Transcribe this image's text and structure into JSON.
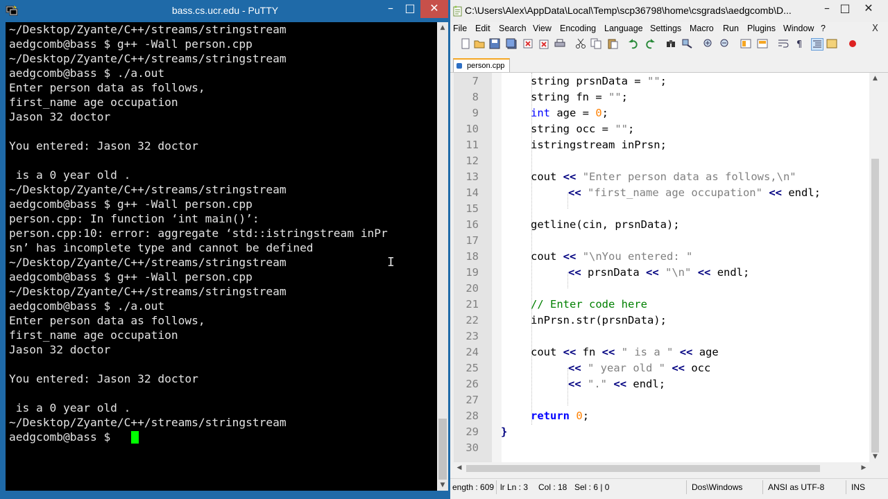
{
  "putty": {
    "title": "bass.cs.ucr.edu - PuTTY",
    "minimize_glyph": "–",
    "maximize_glyph": "□",
    "close_glyph": "✕",
    "terminal_lines": [
      "~/Desktop/Zyante/C++/streams/stringstream",
      "aedgcomb@bass $ g++ -Wall person.cpp",
      "~/Desktop/Zyante/C++/streams/stringstream",
      "aedgcomb@bass $ ./a.out",
      "Enter person data as follows,",
      "first_name age occupation",
      "Jason 32 doctor",
      "",
      "You entered: Jason 32 doctor",
      "",
      " is a 0 year old .",
      "~/Desktop/Zyante/C++/streams/stringstream",
      "aedgcomb@bass $ g++ -Wall person.cpp",
      "person.cpp: In function ‘int main()’:",
      "person.cpp:10: error: aggregate ‘std::istringstream inPr",
      "sn’ has incomplete type and cannot be defined",
      "~/Desktop/Zyante/C++/streams/stringstream",
      "aedgcomb@bass $ g++ -Wall person.cpp",
      "~/Desktop/Zyante/C++/streams/stringstream",
      "aedgcomb@bass $ ./a.out",
      "Enter person data as follows,",
      "first_name age occupation",
      "Jason 32 doctor",
      "",
      "You entered: Jason 32 doctor",
      "",
      " is a 0 year old .",
      "~/Desktop/Zyante/C++/streams/stringstream",
      "aedgcomb@bass $ "
    ],
    "cursor_color": "#00ff00",
    "scroll_up": "▲",
    "scroll_down": "▼"
  },
  "npp": {
    "title": "C:\\Users\\Alex\\AppData\\Local\\Temp\\scp36798\\home\\csgrads\\aedgcomb\\D...",
    "minimize_glyph": "–",
    "maximize_glyph": "□",
    "close_glyph": "✕",
    "menu": [
      "File",
      "Edit",
      "Search",
      "View",
      "Encoding",
      "Language",
      "Settings",
      "Macro",
      "Run",
      "Plugins",
      "Window",
      "?"
    ],
    "menu_close": "X",
    "toolbar_icons": [
      "new-file-icon",
      "open-file-icon",
      "save-icon",
      "save-all-icon",
      "close-icon",
      "close-all-icon",
      "print-icon",
      "cut-icon",
      "copy-icon",
      "paste-icon",
      "undo-icon",
      "redo-icon",
      "find-icon",
      "replace-icon",
      "zoom-in-icon",
      "zoom-out-icon",
      "sync-v-icon",
      "sync-h-icon",
      "word-wrap-icon",
      "show-all-chars-icon",
      "indent-guide-icon",
      "user-lang-icon",
      "record-macro-icon"
    ],
    "tab": "person.cpp",
    "line_numbers": [
      "7",
      "8",
      "9",
      "10",
      "11",
      "12",
      "13",
      "14",
      "15",
      "16",
      "17",
      "18",
      "19",
      "20",
      "21",
      "22",
      "23",
      "24",
      "25",
      "26",
      "27",
      "28",
      "29",
      "30"
    ],
    "code": {
      "l7": {
        "t1": "string prsnData = ",
        "s": "\"\"",
        "t2": ";"
      },
      "l8": {
        "t1": "string fn = ",
        "s": "\"\"",
        "t2": ";"
      },
      "l9": {
        "kw": "int",
        "t1": " age = ",
        "num": "0",
        "t2": ";"
      },
      "l10": {
        "t1": "string occ = ",
        "s": "\"\"",
        "t2": ";"
      },
      "l11": {
        "t1": "istringstream inPrsn;"
      },
      "l13": {
        "t1": "cout ",
        "op": "<<",
        "sp": " ",
        "s": "\"Enter person data as follows,\\n\""
      },
      "l14": {
        "op1": "<<",
        "sp1": " ",
        "s": "\"first_name age occupation\"",
        "sp2": " ",
        "op2": "<<",
        "t1": " endl;"
      },
      "l16": {
        "t1": "getline(cin, prsnData);"
      },
      "l18": {
        "t1": "cout ",
        "op": "<<",
        "sp": " ",
        "s": "\"\\nYou entered: \""
      },
      "l19": {
        "op1": "<<",
        "t1": " prsnData ",
        "op2": "<<",
        "sp": " ",
        "s": "\"\\n\"",
        "sp2": " ",
        "op3": "<<",
        "t2": " endl;"
      },
      "l21": {
        "c": "// Enter code here"
      },
      "l22": {
        "t1": "inPrsn.str(prsnData);"
      },
      "l24": {
        "t1": "cout ",
        "op1": "<<",
        "t2": " fn ",
        "op2": "<<",
        "sp": " ",
        "s": "\" is a \"",
        "sp2": " ",
        "op3": "<<",
        "t3": " age"
      },
      "l25": {
        "op1": "<<",
        "sp": " ",
        "s": "\" year old \"",
        "sp2": " ",
        "op2": "<<",
        "t1": " occ"
      },
      "l26": {
        "op1": "<<",
        "sp": " ",
        "s": "\".\"",
        "sp2": " ",
        "op2": "<<",
        "t1": " endl;"
      },
      "l28": {
        "kw": "return",
        "sp": " ",
        "num": "0",
        "t1": ";"
      },
      "l29": {
        "t1": "}"
      }
    },
    "status": {
      "length": "ength : 609",
      "ln": "lr Ln : 3",
      "col": "Col : 18",
      "sel": "Sel : 6 | 0",
      "eol": "Dos\\Windows",
      "encoding": "ANSI as UTF-8",
      "mode": "INS"
    },
    "scroll_up": "▲",
    "scroll_down": "▼",
    "scroll_left": "◀",
    "scroll_right": "▶"
  }
}
